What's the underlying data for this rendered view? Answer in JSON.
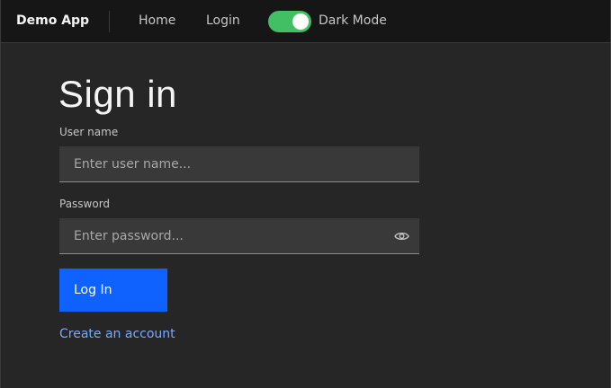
{
  "header": {
    "brand": "Demo App",
    "nav": [
      {
        "label": "Home"
      },
      {
        "label": "Login"
      }
    ],
    "dark_mode": {
      "label": "Dark Mode",
      "enabled": true
    }
  },
  "form": {
    "title": "Sign in",
    "username": {
      "label": "User name",
      "value": "",
      "placeholder": "Enter user name..."
    },
    "password": {
      "label": "Password",
      "value": "",
      "placeholder": "Enter password...",
      "reveal_icon": "eye-icon"
    },
    "submit_label": "Log In",
    "create_account_label": "Create an account"
  },
  "colors": {
    "header_bg": "#161616",
    "page_bg": "#262626",
    "field_bg": "#393939",
    "primary": "#0f62fe",
    "link": "#78a9ff",
    "toggle_on": "#42be65"
  }
}
